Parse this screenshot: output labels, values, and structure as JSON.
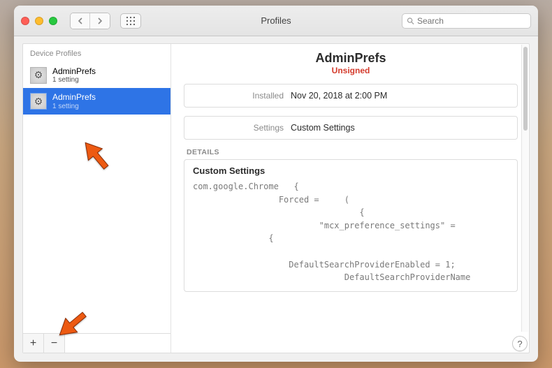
{
  "window": {
    "title": "Profiles"
  },
  "search": {
    "placeholder": "Search",
    "value": ""
  },
  "sidebar": {
    "header": "Device Profiles",
    "items": [
      {
        "name": "AdminPrefs",
        "sub": "1 setting",
        "selected": false
      },
      {
        "name": "AdminPrefs",
        "sub": "1 setting",
        "selected": true
      }
    ],
    "add_label": "+",
    "remove_label": "−"
  },
  "detail": {
    "title": "AdminPrefs",
    "badge": "Unsigned",
    "rows": [
      {
        "label": "Installed",
        "value": "Nov 20, 2018 at 2:00 PM"
      },
      {
        "label": "Settings",
        "value": "Custom Settings"
      }
    ],
    "section_header": "DETAILS",
    "custom_title": "Custom Settings",
    "code": "com.google.Chrome   {\n                 Forced =     (\n                                 {\n                         \"mcx_preference_settings\" =\n               {\n\n                   DefaultSearchProviderEnabled = 1;\n                              DefaultSearchProviderName"
  },
  "help_label": "?"
}
